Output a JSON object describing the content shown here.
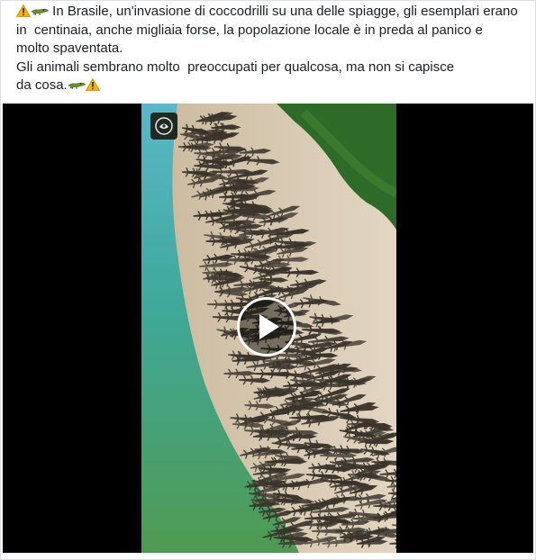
{
  "post": {
    "text_line_1": "In Brasile, un'invasione di coccodrilli su una delle spiagge, gli esemplari erano",
    "text_line_2": "in  centinaia, anche migliaia forse, la popolazione locale è in preda al panico e",
    "text_line_3": "molto spaventata.",
    "text_line_4": "Gli animali sembrano molto  preoccupati per qualcosa, ma non si capisce",
    "text_line_5": "da cosa.",
    "icons": {
      "warning": "warning-icon",
      "crocodile": "crocodile-icon"
    },
    "colors": {
      "text": "#1c1e21",
      "warning_yellow": "#f5b400",
      "croc_green": "#6d8f2e"
    }
  },
  "video": {
    "icons": {
      "play": "play-icon",
      "channel_logo": "channel-logo-icon"
    },
    "colors": {
      "background": "#000000",
      "water": "#3fa89a",
      "sand": "#d9cbb4",
      "vegetation": "#2f6b28"
    }
  }
}
